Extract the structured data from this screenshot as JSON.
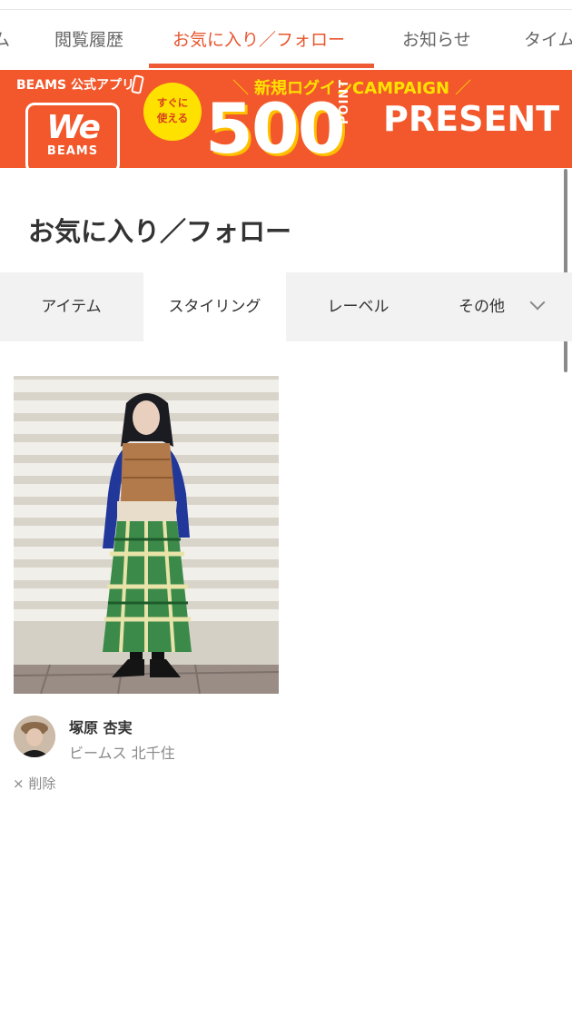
{
  "nav": {
    "tabs": [
      {
        "label": "ム"
      },
      {
        "label": "閲覧履歴"
      },
      {
        "label": "お気に入り／フォロー"
      },
      {
        "label": "お知らせ"
      },
      {
        "label": "タイム"
      }
    ],
    "active_index": 2
  },
  "banner": {
    "app_label": "BEAMS 公式アプリ",
    "logo_we": "We",
    "logo_brand": "BEAMS",
    "campaign": "新規ログインCAMPAIGN",
    "badge_line1": "すぐに",
    "badge_line2": "使える",
    "points": "500",
    "point_word": "POINT",
    "present": "PRESENT"
  },
  "page": {
    "title": "お気に入り／フォロー"
  },
  "subtabs": [
    {
      "label": "アイテム"
    },
    {
      "label": "スタイリング"
    },
    {
      "label": "レーベル"
    },
    {
      "label": "その他"
    }
  ],
  "card": {
    "staff_name": "塚原 杏実",
    "shop": "ビームス 北千住",
    "delete_label": "× 削除"
  },
  "colors": {
    "accent": "#ee5a33",
    "banner_bg": "#f2582c",
    "badge_yellow": "#ffe100",
    "subtab_bg": "#f2f2f2",
    "muted_text": "#8a8a8a"
  }
}
